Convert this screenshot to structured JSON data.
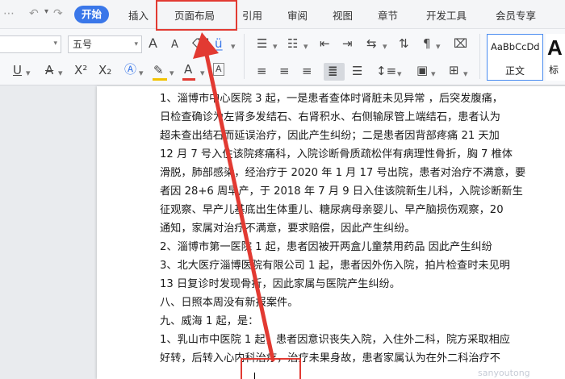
{
  "menubar": {
    "tabs": [
      {
        "label": "开始",
        "active": true
      },
      {
        "label": "插入"
      },
      {
        "label": "页面布局"
      },
      {
        "label": "引用"
      },
      {
        "label": "审阅"
      },
      {
        "label": "视图"
      },
      {
        "label": "章节"
      },
      {
        "label": "开发工具"
      },
      {
        "label": "会员专享"
      }
    ]
  },
  "ribbon": {
    "font_size": "五号",
    "font_grow": "A",
    "font_shrink": "A",
    "format_b": "A",
    "style_primary_sample": "AaBbCcDd",
    "style_primary_name": "正文",
    "style_secondary_sample": "A",
    "style_secondary_name": "标",
    "colors": {
      "highlight": "#f2c200",
      "font_color": "#e23a32",
      "accent": "#3a77e9"
    }
  },
  "document": {
    "lines": [
      "1、淄博市中心医院 3 起，一是患者查体时肾脏未见异常 ，后突发腹痛，",
      "日检查确诊为左肾多发结石、右肾积水、右侧输尿管上端结石，患者认为",
      "超未查出结石而延误治疗，因此产生纠纷；二是患者因背部疼痛 21 天加",
      "12 月 7 号入住该院疼痛科，入院诊断骨质疏松伴有病理性骨折，胸 7 椎体",
      "滑脱，肺部感染，经治疗于 2020 年 1 月 17 号出院，患者对治疗不满意，要",
      "者因 28+6 周早产，于 2018 年 7 月 9 日入住该院新生儿科，入院诊断新生",
      "征观察、早产儿基底出生体重儿、糖尿病母亲婴儿、早产脑损伤观察，20",
      "通知，家属对治疗不满意，要求赔偿，因此产生纠纷。",
      "2、淄博市第一医院 1 起，患者因被开两盒儿童禁用药品 因此产生纠纷",
      "3、北大医疗淄博医院有限公司 1 起，患者因外伤入院，拍片检查时未见明",
      "13 日复诊时发现骨折，因此家属与医院产生纠纷。",
      "八、日照本周没有新报案件。",
      "九、威海 1 起，是：",
      "1、乳山市中医院 1 起，患者因意识丧失入院，入住外二科，院方采取相应",
      "好转，后转入心内科治疗，治疗未果身故，患者家属认为在外二科治疗不"
    ],
    "watermark": "sanyoutong"
  },
  "annotations": {
    "color": "#e23a32"
  }
}
